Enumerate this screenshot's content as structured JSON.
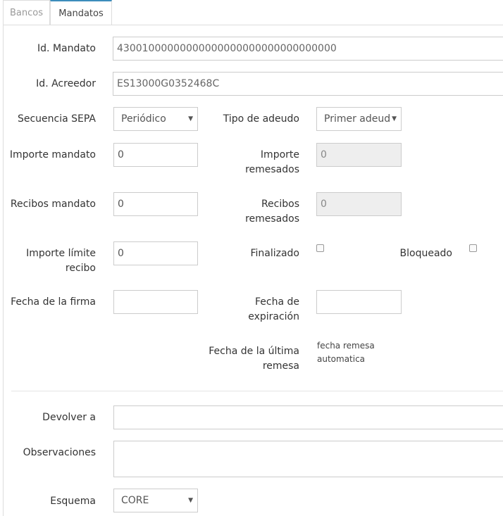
{
  "tabs": [
    {
      "label": "Bancos"
    },
    {
      "label": "Mandatos"
    }
  ],
  "form": {
    "id_mandato": {
      "label": "Id. Mandato",
      "value": "43001000000000000000000000000000000"
    },
    "id_acreedor": {
      "label": "Id. Acreedor",
      "value": "ES13000G0352468C"
    },
    "secuencia_sepa": {
      "label": "Secuencia SEPA",
      "value": "Periódico"
    },
    "tipo_adeudo": {
      "label": "Tipo de adeudo",
      "value": "Primer adeudo"
    },
    "importe_mandato": {
      "label": "Importe mandato",
      "value": "0"
    },
    "importe_remesados": {
      "label_line1": "Importe",
      "label_line2": "remesados",
      "value": "0"
    },
    "recibos_mandato": {
      "label": "Recibos mandato",
      "value": "0"
    },
    "recibos_remesados": {
      "label_line1": "Recibos",
      "label_line2": "remesados",
      "value": "0"
    },
    "importe_limite": {
      "label_line1": "Importe límite",
      "label_line2": "recibo",
      "value": "0"
    },
    "finalizado": {
      "label": "Finalizado",
      "checked": false
    },
    "bloqueado": {
      "label": "Bloqueado",
      "checked": false
    },
    "fecha_firma": {
      "label": "Fecha de la firma",
      "value": ""
    },
    "fecha_expiracion": {
      "label_line1": "Fecha de",
      "label_line2": "expiración",
      "value": ""
    },
    "fecha_ultima_remesa": {
      "label_line1": "Fecha de la última",
      "label_line2": "remesa",
      "value_line1": "fecha remesa",
      "value_line2": "automatica"
    },
    "devolver_a": {
      "label": "Devolver a",
      "value": ""
    },
    "observaciones": {
      "label": "Observaciones",
      "value": ""
    },
    "esquema": {
      "label": "Esquema",
      "value": "CORE"
    }
  },
  "icons": {
    "select_caret": "caret-down-icon"
  }
}
